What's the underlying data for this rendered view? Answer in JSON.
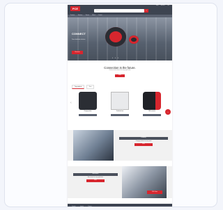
{
  "header": {
    "logo": "PCE",
    "search_placeholder": "Search",
    "search_button": "⌕",
    "links": [
      "Help",
      "Account",
      "Cart"
    ]
  },
  "nav": {
    "items": [
      "Products",
      "Solutions",
      "Service",
      "About",
      "Contact"
    ]
  },
  "hero": {
    "headline": "CONNECT",
    "subtext": "Power distribution solutions",
    "cta": "Discover",
    "dots": "• • •"
  },
  "section": {
    "title": "Connection is the future.",
    "text": "Products and solutions for every application",
    "button": "More"
  },
  "tabs": [
    "Top products",
    "New"
  ],
  "products": [
    {
      "name": "Charging station"
    },
    {
      "name": "Distribution box"
    },
    {
      "name": "CEE connector"
    }
  ],
  "carousel": {
    "prev": "‹",
    "next": "›"
  },
  "banner1": {
    "title": "E-Mobility",
    "text": "Charging solutions for every need",
    "button": "More"
  },
  "banner2": {
    "title": "Accessories",
    "text": "Accessories for every application",
    "button": "More",
    "photo_label": "PCE Online"
  },
  "footer": {
    "items": [
      "Contact",
      "Imprint",
      "Privacy"
    ]
  },
  "colors": {
    "brand_red": "#d7262e",
    "header_dark": "#3d4451"
  }
}
